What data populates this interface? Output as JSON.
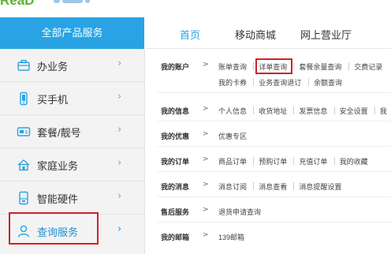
{
  "brand": {
    "logo_text": "ReaD",
    "colors": {
      "accent": "#29a3e3",
      "highlight": "#cd2329",
      "logo_green": "#5cb531"
    }
  },
  "sidebar": {
    "header": "全部产品服务",
    "items": [
      {
        "label": "办业务",
        "icon": "briefcase-icon"
      },
      {
        "label": "买手机",
        "icon": "phone-icon"
      },
      {
        "label": "套餐/靓号",
        "icon": "sim-card-icon"
      },
      {
        "label": "家庭业务",
        "icon": "home-icon"
      },
      {
        "label": "智能硬件",
        "icon": "device-icon"
      },
      {
        "label": "查询服务",
        "icon": "user-icon",
        "active": true
      }
    ],
    "chevron": "›"
  },
  "topnav": {
    "items": [
      {
        "label": "首页",
        "active": true
      },
      {
        "label": "移动商城"
      },
      {
        "label": "网上营业厅"
      }
    ]
  },
  "content": {
    "arrow": ">",
    "rows": [
      {
        "label": "我的账户",
        "lines": [
          [
            "账单查询",
            "详单查询",
            "套餐余量查询",
            "交费记录"
          ],
          [
            "我的卡券",
            "业务查询退订",
            "余额查询"
          ]
        ]
      },
      {
        "label": "我的信息",
        "lines": [
          [
            "个人信息",
            "收货地址",
            "发票信息",
            "安全设置",
            "我"
          ]
        ]
      },
      {
        "label": "我的优惠",
        "lines": [
          [
            "优惠专区"
          ]
        ]
      },
      {
        "label": "我的订单",
        "lines": [
          [
            "商品订单",
            "预购订单",
            "充值订单",
            "我的收藏"
          ]
        ]
      },
      {
        "label": "我的消息",
        "lines": [
          [
            "消息订阅",
            "消息查看",
            "消息提醒设置"
          ]
        ]
      },
      {
        "label": "售后服务",
        "lines": [
          [
            "退货申请查询"
          ]
        ]
      },
      {
        "label": "我的邮箱",
        "lines": [
          [
            "139邮箱"
          ]
        ]
      }
    ]
  }
}
